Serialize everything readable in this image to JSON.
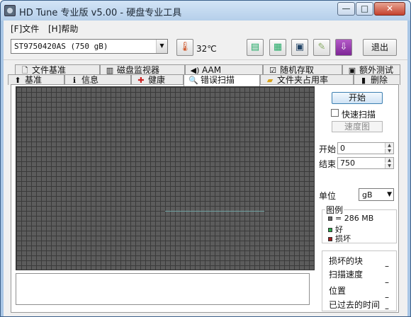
{
  "window": {
    "title": "HD Tune 专业版 v5.00 - 硬盘专业工具",
    "min_glyph": "—",
    "max_glyph": "□",
    "close_glyph": "✕"
  },
  "menu": {
    "file": "[F]文件",
    "help": "[H]帮助"
  },
  "toolbar": {
    "drive": "ST9750420AS (750 gB)",
    "temperature": "32℃",
    "exit": "退出"
  },
  "tabs_top": [
    {
      "label": "文件基准",
      "icon": "document-icon"
    },
    {
      "label": "磁盘监视器",
      "icon": "monitor-icon"
    },
    {
      "label": "AAM",
      "icon": "speaker-icon"
    },
    {
      "label": "随机存取",
      "icon": "random-access-icon"
    },
    {
      "label": "额外测试",
      "icon": "extra-tests-icon"
    }
  ],
  "tabs_bottom": [
    {
      "label": "基准",
      "icon": "benchmark-icon"
    },
    {
      "label": "信息",
      "icon": "info-icon"
    },
    {
      "label": "健康",
      "icon": "health-icon"
    },
    {
      "label": "错误扫描",
      "icon": "magnifier-icon"
    },
    {
      "label": "文件夹占用率",
      "icon": "folder-icon"
    },
    {
      "label": "删除",
      "icon": "trash-icon"
    }
  ],
  "scan": {
    "start_button": "开始",
    "quick_scan": "快速扫描",
    "quick_scan_checked": false,
    "speed_map": "速度图",
    "start_label": "开始",
    "start_value": "0",
    "end_label": "结束",
    "end_value": "750",
    "unit_label": "单位",
    "unit_value": "gB",
    "legend_title": "图例",
    "legend_block": "= 286 MB",
    "legend_good": "好",
    "legend_bad": "损坏",
    "stats": {
      "bad_blocks": "损坏的块",
      "scan_speed": "扫描速度",
      "position": "位置",
      "elapsed": "已过去的时间",
      "bad_blocks_value": "–",
      "scan_speed_value": "–",
      "position_value": "–",
      "elapsed_value": "–"
    }
  },
  "colors": {
    "grid_fill": "#5c5c5c",
    "good": "#2aa84a",
    "bad": "#a32020",
    "block": "#6a6a6a"
  }
}
